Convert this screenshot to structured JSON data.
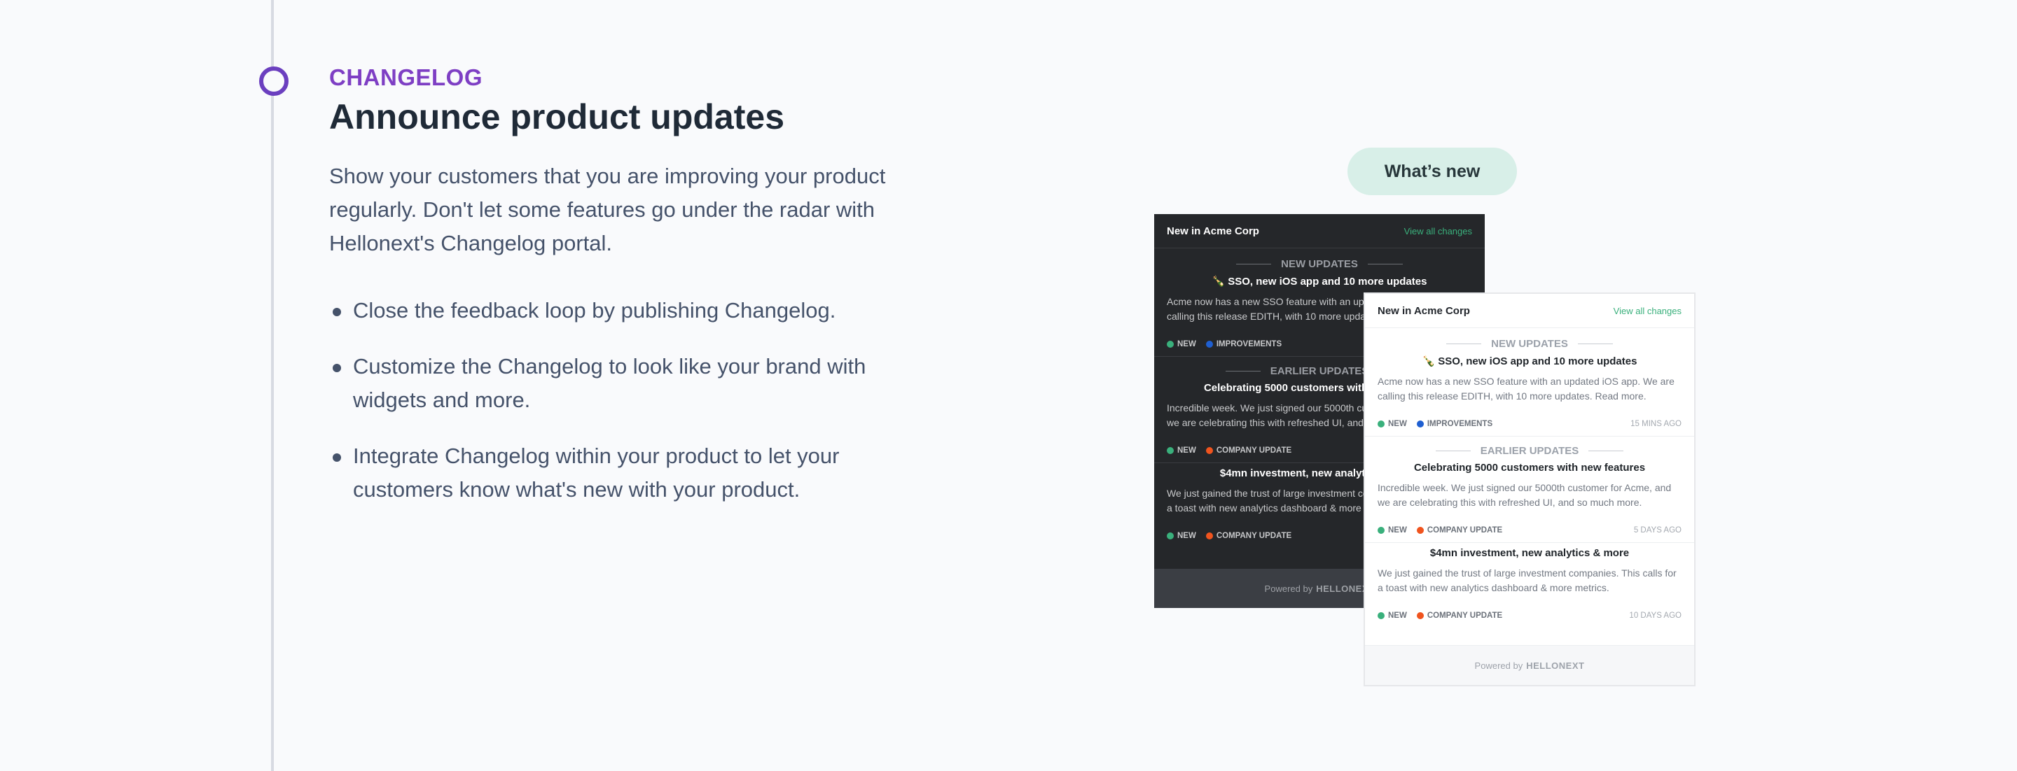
{
  "section": {
    "eyebrow": "CHANGELOG",
    "heading": "Announce product updates",
    "description": "Show your customers that you are improving your product regularly. Don't let some features go under the radar with Hellonext's Changelog portal.",
    "bullets": [
      "Close the feedback loop by publishing Changelog.",
      "Customize the Changelog to look like your brand with widgets and more.",
      "Integrate Changelog within your product to let your customers know what's new with your product."
    ]
  },
  "whats_new_button": "What’s new",
  "widget": {
    "title": "New in Acme Corp",
    "view_all": "View all changes",
    "new_updates_label": "NEW UPDATES",
    "earlier_updates_label": "EARLIER UPDATES",
    "entries": [
      {
        "title": "SSO, new iOS app and 10 more updates",
        "body": "Acme now has a new SSO feature with an updated iOS app. We are calling this release EDITH, with 10 more updates. Read more.",
        "tag1": "NEW",
        "tag2": "IMPROVEMENTS",
        "time": "15 MINS AGO"
      },
      {
        "title": "Celebrating 5000 customers with new features",
        "body": "Incredible week. We just signed our 5000th customer for Acme, and we are celebrating this with refreshed UI, and so much more.",
        "tag1": "NEW",
        "tag2": "COMPANY UPDATE",
        "time": "5 DAYS AGO"
      },
      {
        "title": "$4mn investment, new analytics & more",
        "body": "We just gained the trust of large investment companies. This calls for a toast with new analytics dashboard & more metrics.",
        "tag1": "NEW",
        "tag2": "COMPANY UPDATE",
        "time": "10 DAYS AGO"
      }
    ],
    "powered_by": "Powered by",
    "brand": "HELLONEXT",
    "emoji": "🍾"
  },
  "colors": {
    "accent": "#7e3fc4",
    "new_tag": "#3ab07c",
    "improvements_tag": "#1f5fd1",
    "company_update_tag": "#f0541e"
  }
}
